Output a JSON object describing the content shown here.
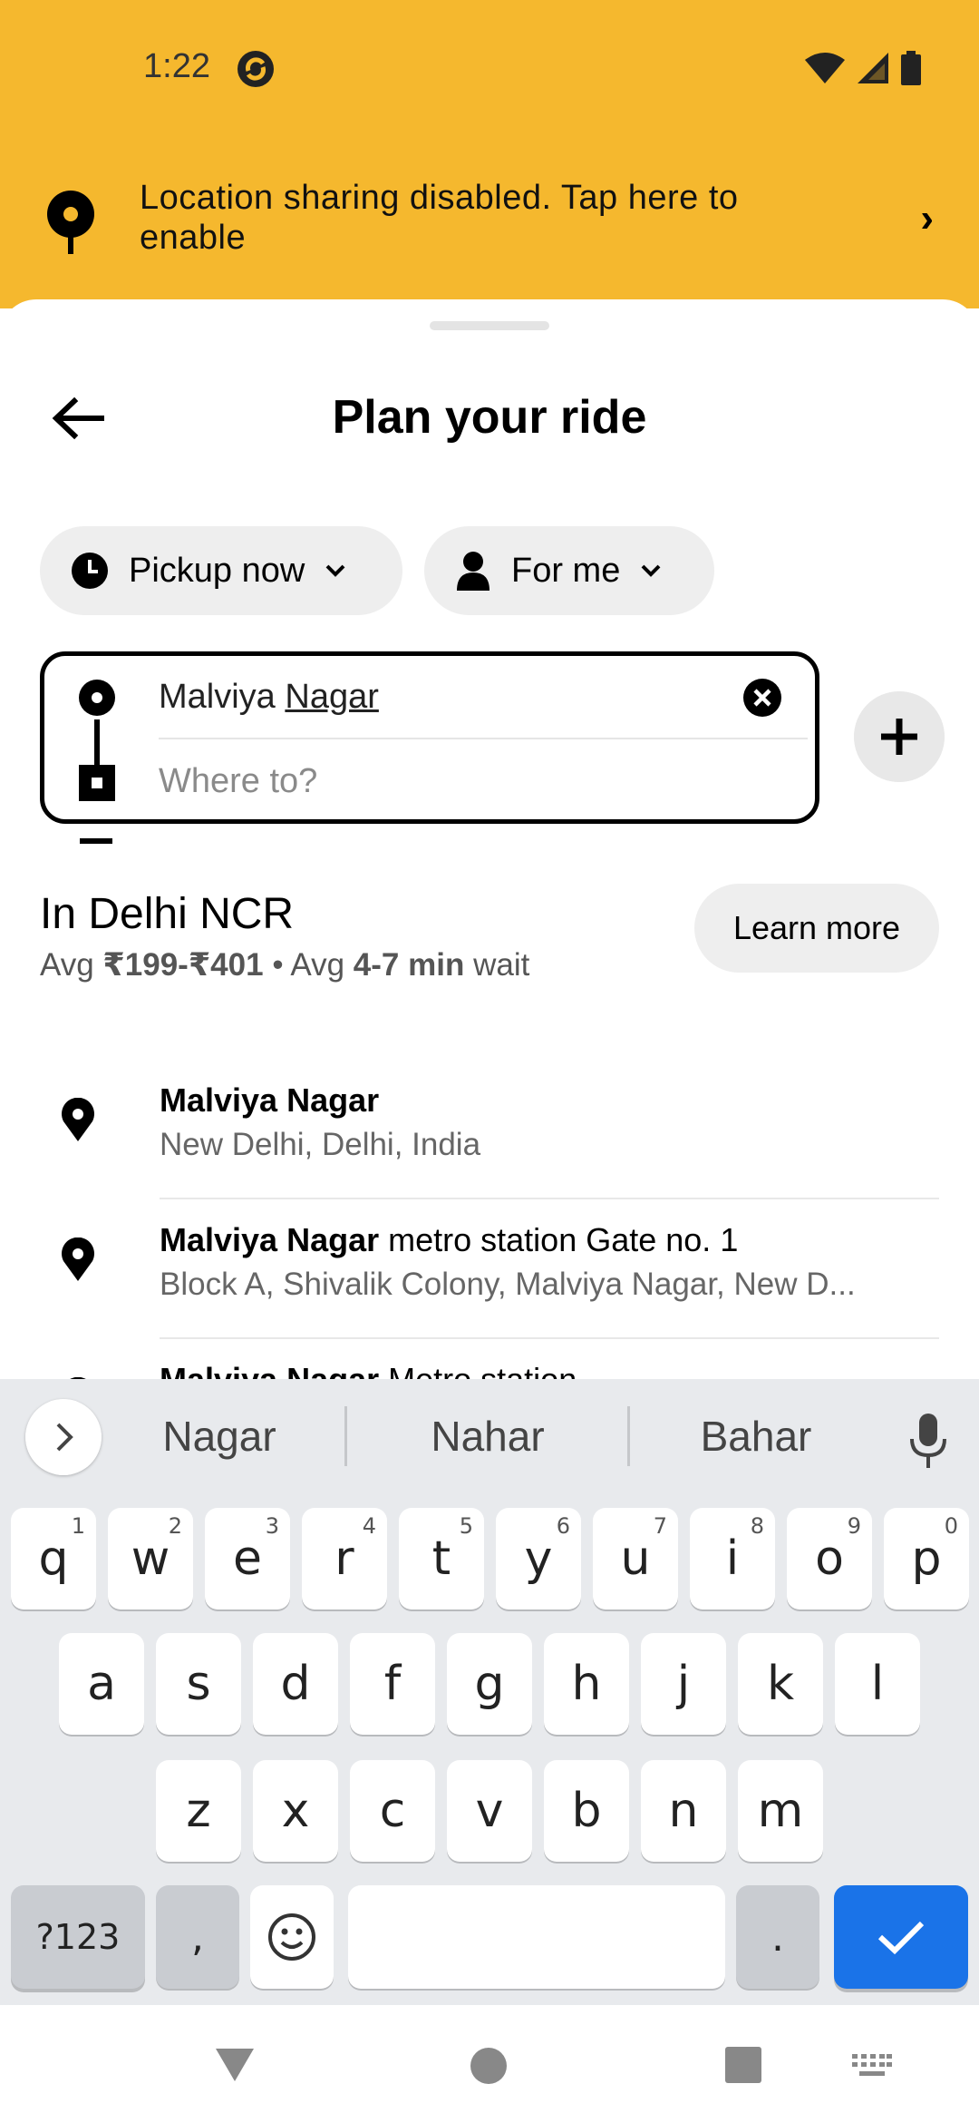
{
  "status_bar": {
    "time": "1:22"
  },
  "banner": {
    "text": "Location sharing disabled. Tap here to enable",
    "chevron": "›"
  },
  "sheet": {
    "title": "Plan your ride",
    "chips": {
      "pickup_label": "Pickup now",
      "rider_label": "For me"
    },
    "route": {
      "pickup_word1": "Malviya",
      "pickup_word2": "Nagar",
      "destination_placeholder": "Where to?"
    },
    "region": {
      "title": "In Delhi NCR",
      "avg_label": "Avg",
      "price_range": "₹199-₹401",
      "separator": "•",
      "avg_label2": "Avg",
      "wait_time": "4-7 min",
      "wait_label": "wait",
      "learn_more_label": "Learn more"
    },
    "results": [
      {
        "title_bold": "Malviya Nagar",
        "title_rest": "",
        "subtitle": "New Delhi, Delhi, India"
      },
      {
        "title_bold": "Malviya Nagar",
        "title_rest": " metro station Gate no. 1",
        "subtitle": "Block A, Shivalik Colony, Malviya Nagar, New D..."
      },
      {
        "title_bold": "Malviya Nagar",
        "title_rest": " Metro station",
        "subtitle": ""
      }
    ]
  },
  "keyboard": {
    "suggestions": [
      "Nagar",
      "Nahar",
      "Bahar"
    ],
    "row1": [
      {
        "k": "q",
        "h": "1"
      },
      {
        "k": "w",
        "h": "2"
      },
      {
        "k": "e",
        "h": "3"
      },
      {
        "k": "r",
        "h": "4"
      },
      {
        "k": "t",
        "h": "5"
      },
      {
        "k": "y",
        "h": "6"
      },
      {
        "k": "u",
        "h": "7"
      },
      {
        "k": "i",
        "h": "8"
      },
      {
        "k": "o",
        "h": "9"
      },
      {
        "k": "p",
        "h": "0"
      }
    ],
    "row2": [
      "a",
      "s",
      "d",
      "f",
      "g",
      "h",
      "j",
      "k",
      "l"
    ],
    "row3": [
      "z",
      "x",
      "c",
      "v",
      "b",
      "n",
      "m"
    ],
    "symbols_label": "?123",
    "comma_label": ",",
    "period_label": "."
  },
  "icons": {
    "status_app": "app-notification-icon",
    "wifi": "wifi-icon",
    "signal": "signal-icon",
    "battery": "battery-icon",
    "banner_pin": "location-pin-icon",
    "back": "back-arrow-icon",
    "clock": "clock-icon",
    "person": "person-icon",
    "clear": "clear-icon",
    "add": "plus-icon",
    "mic": "microphone-icon",
    "shift": "shift-icon",
    "backspace": "backspace-icon",
    "emoji": "emoji-icon",
    "enter": "checkmark-icon",
    "nav_back": "nav-back-icon",
    "nav_home": "nav-home-icon",
    "nav_recents": "nav-recents-icon",
    "nav_keyboard": "keyboard-switch-icon"
  },
  "colors": {
    "banner_bg": "#f5b82e",
    "enter_key": "#1a73e8",
    "keyboard_bg": "#e8eaed"
  }
}
